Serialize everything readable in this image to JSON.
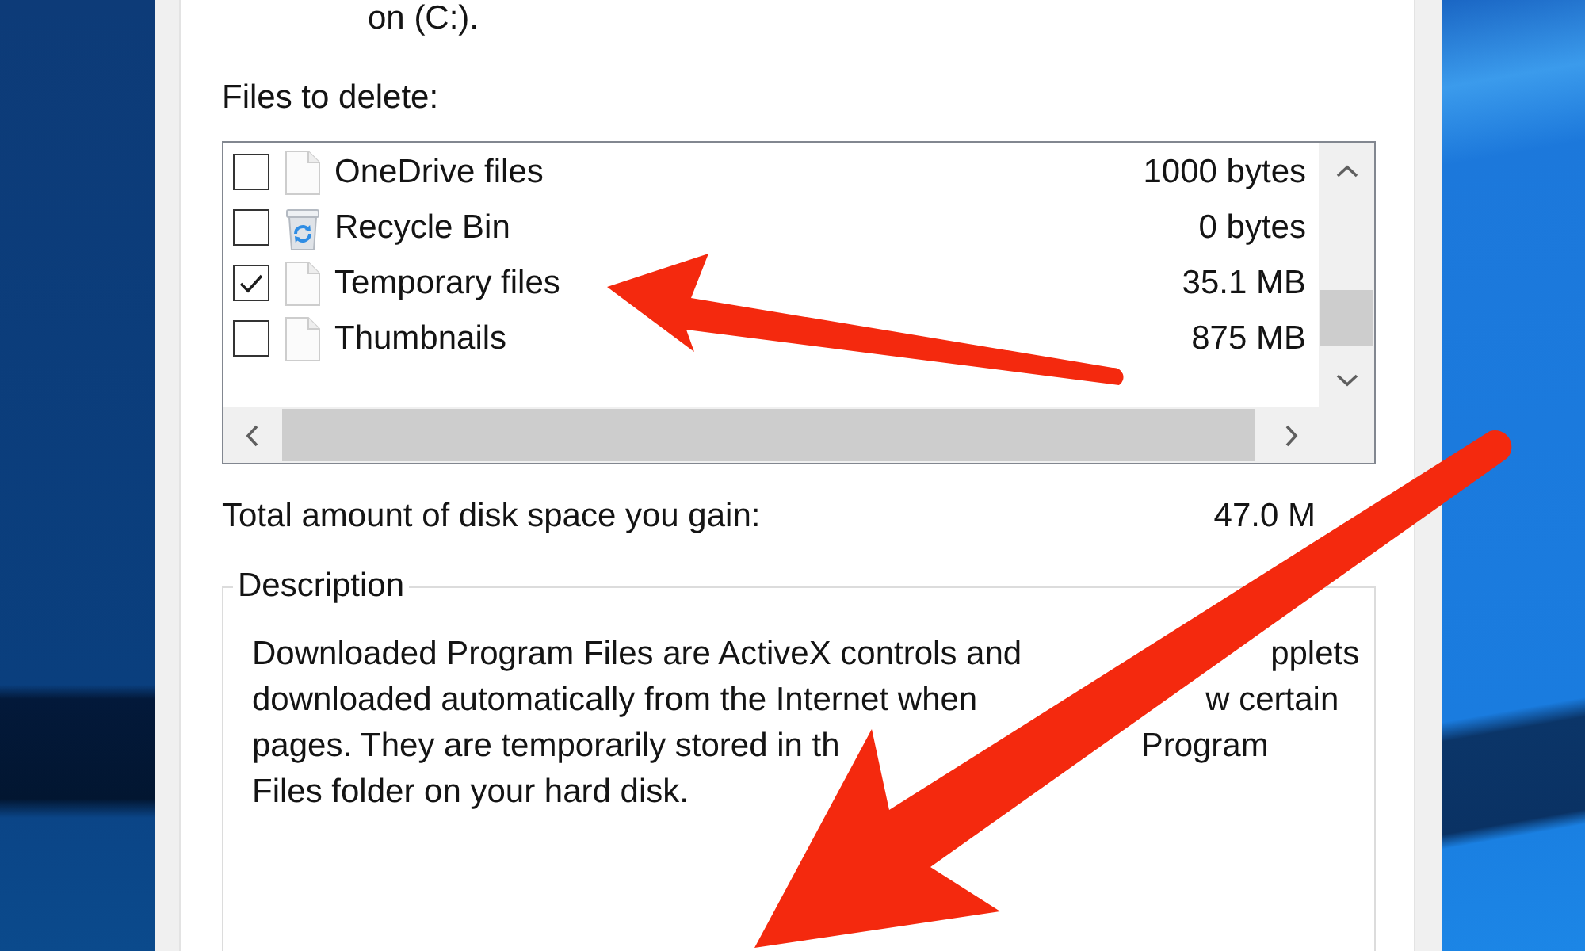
{
  "summary": "on (C:).",
  "files_label": "Files to delete:",
  "files": [
    {
      "kind": "file",
      "name": "OneDrive files",
      "size": "1000 bytes",
      "checked": false
    },
    {
      "kind": "recycle_bin",
      "name": "Recycle Bin",
      "size": "0 bytes",
      "checked": false
    },
    {
      "kind": "file",
      "name": "Temporary files",
      "size": "35.1 MB",
      "checked": true
    },
    {
      "kind": "file",
      "name": "Thumbnails",
      "size": "875 MB",
      "checked": false
    }
  ],
  "total": {
    "label": "Total amount of disk space you gain:",
    "value": "47.0 M"
  },
  "description": {
    "title": "Description",
    "lines": [
      {
        "parts": [
          "Downloaded Program Files are ActiveX controls and",
          "pplets"
        ]
      },
      {
        "parts": [
          "downloaded automatically from the Internet when",
          "w certain"
        ]
      },
      {
        "parts": [
          "pages. They are temporarily stored in th",
          "Program"
        ]
      },
      {
        "parts": [
          "Files folder on your hard disk."
        ]
      }
    ]
  }
}
